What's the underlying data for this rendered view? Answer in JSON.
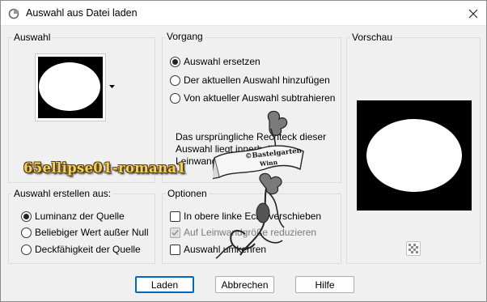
{
  "window": {
    "title": "Auswahl aus Datei laden"
  },
  "auswahl_group": {
    "label": "Auswahl"
  },
  "vorgang_group": {
    "label": "Vorgang",
    "options": [
      {
        "label": "Auswahl ersetzen",
        "checked": true
      },
      {
        "label": "Der aktuellen Auswahl hinzufügen",
        "checked": false
      },
      {
        "label": "Von aktueller Auswahl subtrahieren",
        "checked": false
      }
    ],
    "description": "Das ursprüngliche Rechteck dieser Auswahl liegt innerhalb der Leinwand."
  },
  "vorschau_group": {
    "label": "Vorschau"
  },
  "erstellen_group": {
    "label": "Auswahl erstellen aus:",
    "options": [
      {
        "label": "Luminanz der Quelle",
        "checked": true
      },
      {
        "label": "Beliebiger Wert außer Null",
        "checked": false
      },
      {
        "label": "Deckfähigkeit der Quelle",
        "checked": false
      }
    ]
  },
  "optionen_group": {
    "label": "Optionen",
    "options": [
      {
        "label": "In obere linke Ecke verschieben",
        "checked": false,
        "disabled": false
      },
      {
        "label": "Auf Leinwandgröße reduzieren",
        "checked": true,
        "disabled": true
      },
      {
        "label": "Auswahl umkehren",
        "checked": false,
        "disabled": false
      }
    ]
  },
  "buttons": {
    "load": "Laden",
    "cancel": "Abbrechen",
    "help": "Hilfe"
  },
  "overlay": {
    "filename_text": "65ellipse01-romana1",
    "watermark_line1": "©Bastelgarten",
    "watermark_line2": "Winn"
  },
  "colors": {
    "accent": "#0067c0",
    "preview_bg": "#000000",
    "ellipse": "#ffffff"
  },
  "icons": {
    "app": "app-icon",
    "close": "close-icon",
    "dropdown": "dropdown-arrow-icon",
    "transparency": "checkerboard-icon"
  }
}
